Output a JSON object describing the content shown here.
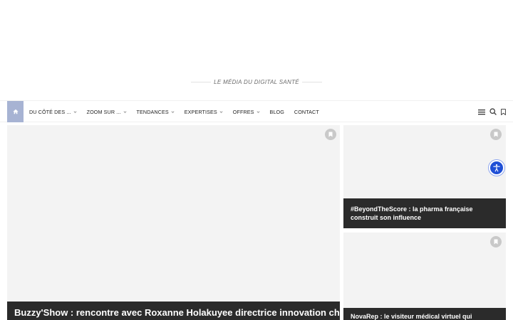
{
  "tagline": "LE MÉDIA DU DIGITAL SANTÉ",
  "nav": {
    "items": [
      {
        "label": "DU CÔTÉ DES ...",
        "has_dropdown": true
      },
      {
        "label": "ZOOM SUR ...",
        "has_dropdown": true
      },
      {
        "label": "TENDANCES",
        "has_dropdown": true
      },
      {
        "label": "EXPERTISES",
        "has_dropdown": true
      },
      {
        "label": "OFFRES",
        "has_dropdown": true
      },
      {
        "label": "BLOG",
        "has_dropdown": false
      },
      {
        "label": "CONTACT",
        "has_dropdown": false
      }
    ],
    "icons": [
      "home-icon",
      "hamburger-menu-icon",
      "search-icon",
      "bookmark-icon"
    ]
  },
  "articles": {
    "main": {
      "title": "Buzzy'Show : rencontre avec Roxanne Holakuyee directrice innovation chez"
    },
    "side1": {
      "title": "#BeyondTheScore : la pharma française construit son influence"
    },
    "side2": {
      "title": "NovaRep : le visiteur médical virtuel qui"
    }
  },
  "colors": {
    "home_accent": "#a7b3d3",
    "caption_bg": "#2b2b2b",
    "accessibility": "#1f4fd6"
  }
}
